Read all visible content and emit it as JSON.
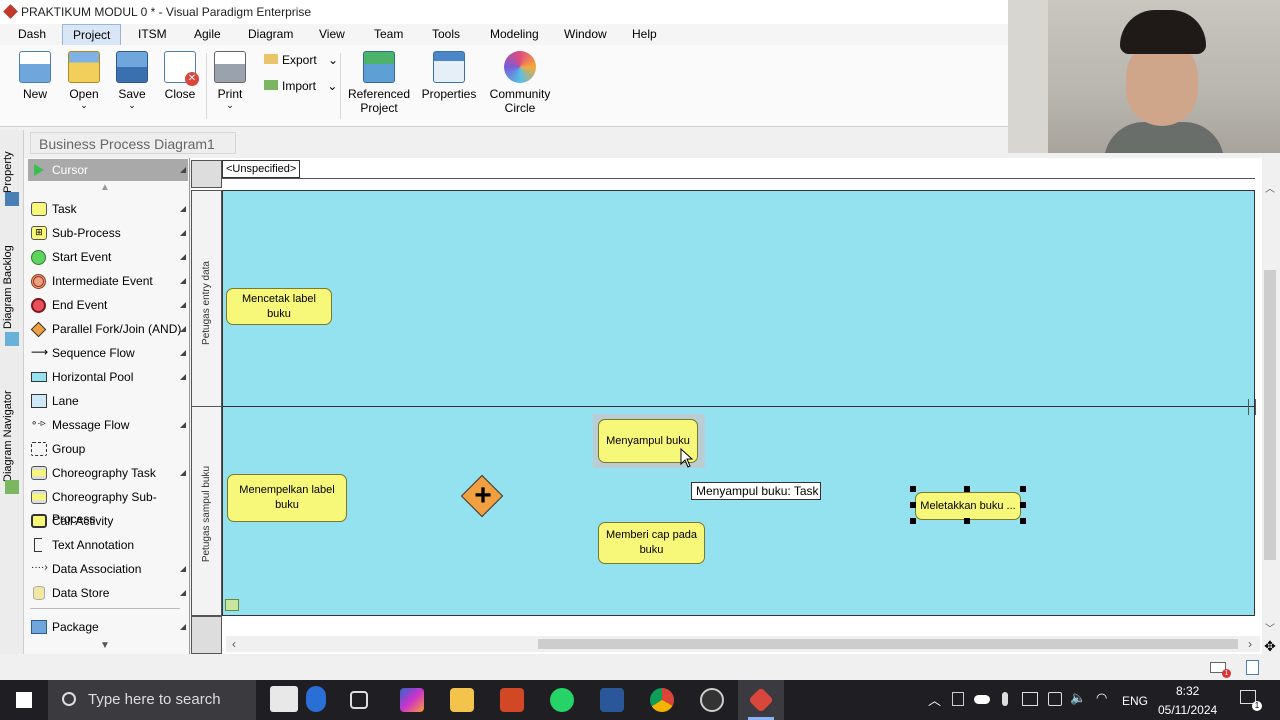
{
  "window": {
    "title": "PRAKTIKUM MODUL 0 * - Visual Paradigm Enterprise"
  },
  "menu": [
    "Dash",
    "Project",
    "ITSM",
    "Agile",
    "Diagram",
    "View",
    "Team",
    "Tools",
    "Modeling",
    "Window",
    "Help"
  ],
  "menu_active": "Project",
  "ribbon": {
    "new": "New",
    "open": "Open",
    "save": "Save",
    "close": "Close",
    "print": "Print",
    "export": "Export",
    "import": "Import",
    "referenced_1": "Referenced",
    "referenced_2": "Project",
    "properties": "Properties",
    "community_1": "Community",
    "community_2": "Circle"
  },
  "diagram_tab": "Business Process Diagram1",
  "side_tabs": {
    "property": "Property",
    "backlog": "Diagram Backlog",
    "navigator": "Diagram Navigator"
  },
  "palette": {
    "cursor": "Cursor",
    "items": [
      "Task",
      "Sub-Process",
      "Start Event",
      "Intermediate Event",
      "End Event",
      "Parallel Fork/Join (AND)",
      "Sequence Flow",
      "Horizontal Pool",
      "Lane",
      "Message Flow",
      "Group",
      "Choreography Task",
      "Choreography Sub-Process",
      "Call Activity",
      "Text Annotation",
      "Data Association",
      "Data Store",
      "Package"
    ]
  },
  "canvas": {
    "unspecified": "<Unspecified>",
    "lanes": [
      "Petugas entry data",
      "Petugas sampul buku"
    ],
    "tasks": {
      "mencetak": "Mencetak label buku",
      "menyampul": "Menyampul buku",
      "menempelkan": "Menempelkan label buku",
      "memberi": "Memberi cap pada buku",
      "meletakkan": "Meletakkan buku ..."
    },
    "tooltip": "Menyampul buku: Task"
  },
  "colors": {
    "pool": "#94e2f0",
    "task": "#f7f77a",
    "gateway": "#f0a040"
  },
  "taskbar": {
    "search_placeholder": "Type here to search",
    "time": "8:32",
    "date": "05/11/2024",
    "lang": "ENG"
  }
}
